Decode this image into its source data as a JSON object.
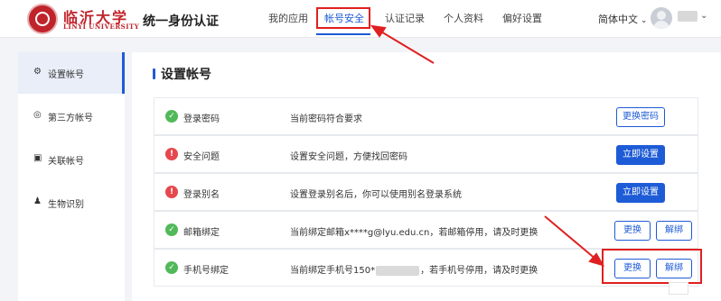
{
  "header": {
    "school_cn": "临沂大学",
    "school_en": "LINYI UNIVERSITY",
    "app_title": "统一身份认证",
    "nav": [
      {
        "label": "我的应用",
        "active": false
      },
      {
        "label": "帐号安全",
        "active": true
      },
      {
        "label": "认证记录",
        "active": false
      },
      {
        "label": "个人资料",
        "active": false
      },
      {
        "label": "偏好设置",
        "active": false
      }
    ],
    "language": "简体中文",
    "avatar_icon": "user-avatar-icon"
  },
  "sidebar": {
    "items": [
      {
        "label": "设置帐号",
        "icon": "gear-icon",
        "active": true
      },
      {
        "label": "第三方帐号",
        "icon": "link-circle-icon",
        "active": false
      },
      {
        "label": "关联帐号",
        "icon": "linked-account-icon",
        "active": false
      },
      {
        "label": "生物识别",
        "icon": "person-icon",
        "active": false
      }
    ]
  },
  "main": {
    "title": "设置帐号",
    "rows": [
      {
        "status": "ok",
        "label": "登录密码",
        "desc": "当前密码符合要求",
        "buttons": [
          {
            "label": "更换密码",
            "style": "outline"
          }
        ]
      },
      {
        "status": "warn",
        "label": "安全问题",
        "desc": "设置安全问题，方便找回密码",
        "buttons": [
          {
            "label": "立即设置",
            "style": "primary"
          }
        ]
      },
      {
        "status": "warn",
        "label": "登录别名",
        "desc": "设置登录别名后，你可以使用别名登录系统",
        "buttons": [
          {
            "label": "立即设置",
            "style": "primary"
          }
        ]
      },
      {
        "status": "ok",
        "label": "邮箱绑定",
        "desc": "当前绑定邮箱x****g@lyu.edu.cn，若邮箱停用，请及时更换",
        "buttons": [
          {
            "label": "更换",
            "style": "outline"
          },
          {
            "label": "解绑",
            "style": "outline"
          }
        ]
      },
      {
        "status": "ok",
        "label": "手机号绑定",
        "desc_prefix": "当前绑定手机号150*",
        "desc_suffix": "，若手机号停用，请及时更换",
        "buttons": [
          {
            "label": "更换",
            "style": "outline"
          },
          {
            "label": "解绑",
            "style": "outline"
          }
        ]
      }
    ]
  },
  "colors": {
    "accent": "#1e5bd6",
    "brand_red": "#c0242b",
    "ok": "#52b95a",
    "warn": "#e5484d",
    "annotation": "#e02020"
  }
}
